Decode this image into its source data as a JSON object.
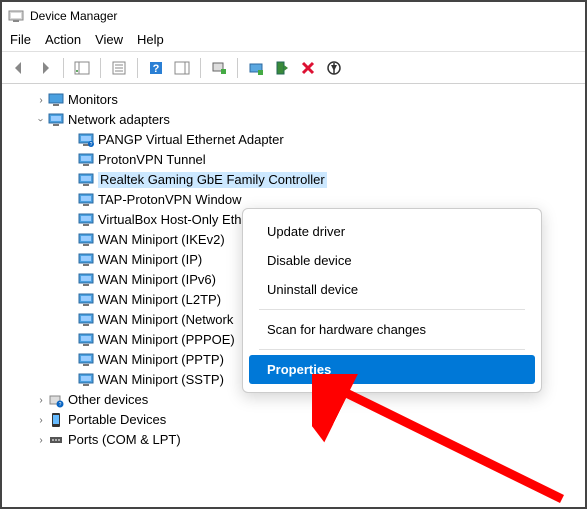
{
  "window": {
    "title": "Device Manager"
  },
  "menu": {
    "file": "File",
    "action": "Action",
    "view": "View",
    "help": "Help"
  },
  "tree": {
    "monitors": "Monitors",
    "network_adapters": "Network adapters",
    "adapters": {
      "pangp": "PANGP Virtual Ethernet Adapter",
      "protonvpn": "ProtonVPN Tunnel",
      "realtek": "Realtek Gaming GbE Family Controller",
      "tap": "TAP-ProtonVPN Window",
      "vbox": "VirtualBox Host-Only Eth",
      "ikev2": "WAN Miniport (IKEv2)",
      "ip": "WAN Miniport (IP)",
      "ipv6": "WAN Miniport (IPv6)",
      "l2tp": "WAN Miniport (L2TP)",
      "network": "WAN Miniport (Network",
      "pppoe": "WAN Miniport (PPPOE)",
      "pptp": "WAN Miniport (PPTP)",
      "sstp": "WAN Miniport (SSTP)"
    },
    "other_devices": "Other devices",
    "portable_devices": "Portable Devices",
    "ports": "Ports (COM & LPT)"
  },
  "context": {
    "update": "Update driver",
    "disable": "Disable device",
    "uninstall": "Uninstall device",
    "scan": "Scan for hardware changes",
    "properties": "Properties"
  }
}
